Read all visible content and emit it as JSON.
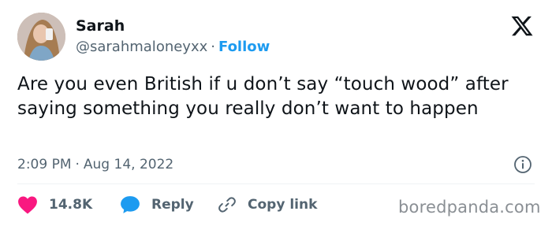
{
  "author": {
    "name": "Sarah",
    "handle": "@sarahmaloneyxx",
    "separator": "·",
    "follow_label": "Follow"
  },
  "tweet": {
    "text": "Are you even British if u don’t say “touch wood” after saying something you really don’t want to happen"
  },
  "meta": {
    "time": "2:09 PM",
    "separator": "·",
    "date": "Aug 14, 2022"
  },
  "actions": {
    "like_count": "14.8K",
    "reply_label": "Reply",
    "copy_label": "Copy link"
  },
  "watermark": "boredpanda.com",
  "icons": {
    "brand": "x-logo-icon",
    "info": "info-icon",
    "like": "heart-icon",
    "reply": "speech-bubble-icon",
    "copy": "link-icon"
  },
  "colors": {
    "accent": "#1d9bf0",
    "like": "#f91880",
    "text": "#0f1419",
    "secondary": "#536471"
  }
}
